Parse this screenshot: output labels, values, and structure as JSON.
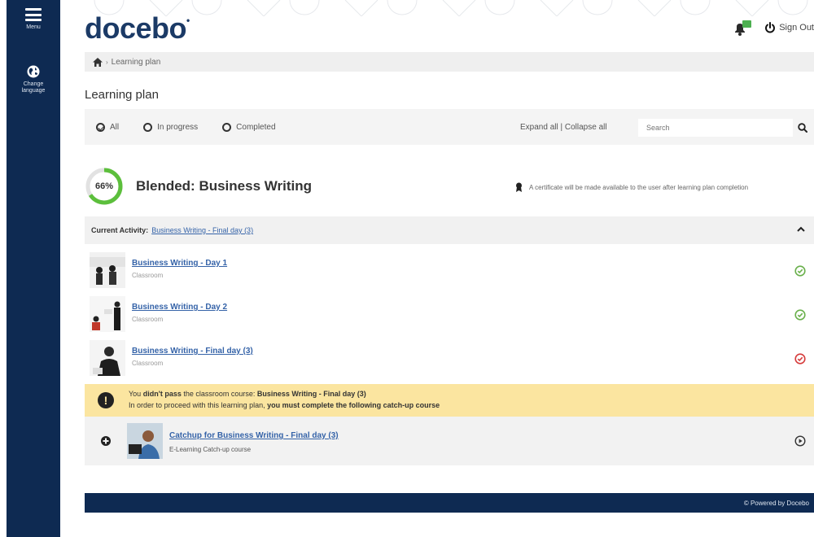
{
  "sidebar": {
    "menu_label": "Menu",
    "language_label": "Change language"
  },
  "header": {
    "logo": "docebo",
    "signout_label": "Sign Out"
  },
  "breadcrumb": {
    "current": "Learning plan"
  },
  "page_title": "Learning plan",
  "filters": {
    "all": "All",
    "in_progress": "In progress",
    "completed": "Completed",
    "selected": "All",
    "expand_all": "Expand all",
    "separator": "|",
    "collapse_all": "Collapse all",
    "search_placeholder": "Search"
  },
  "plan": {
    "progress_label": "66%",
    "progress_value": 0.66,
    "title": "Blended: Business Writing",
    "certificate_note": "A certificate will be made available to the user after learning plan completion"
  },
  "current_activity": {
    "label": "Current Activity:",
    "link": "Business Writing - Final day (3)"
  },
  "courses": [
    {
      "title": "Business Writing - Day 1",
      "type": "Classroom",
      "status": "passed"
    },
    {
      "title": "Business Writing - Day 2",
      "type": "Classroom",
      "status": "passed"
    },
    {
      "title": "Business Writing - Final day (3)",
      "type": "Classroom",
      "status": "failed"
    }
  ],
  "warning": {
    "l1_a": "You ",
    "l1_b": "didn't pass",
    "l1_c": " the classroom course: ",
    "l1_d": "Business Writing - Final day (3)",
    "l2_a": "In order to proceed with this learning plan, ",
    "l2_b": "you must complete the following catch-up course"
  },
  "catchup": {
    "title": "Catchup for Business Writing - Final day (3)",
    "type": "E-Learning",
    "subtype": "Catch-up course"
  },
  "footer": {
    "text": "© Powered by Docebo"
  },
  "colors": {
    "navy": "#0e2a52",
    "link": "#3563a8",
    "success": "#6ab04c",
    "danger": "#d63c3c",
    "warning_bg": "#fbe5a0",
    "progress": "#5cbf3c"
  }
}
